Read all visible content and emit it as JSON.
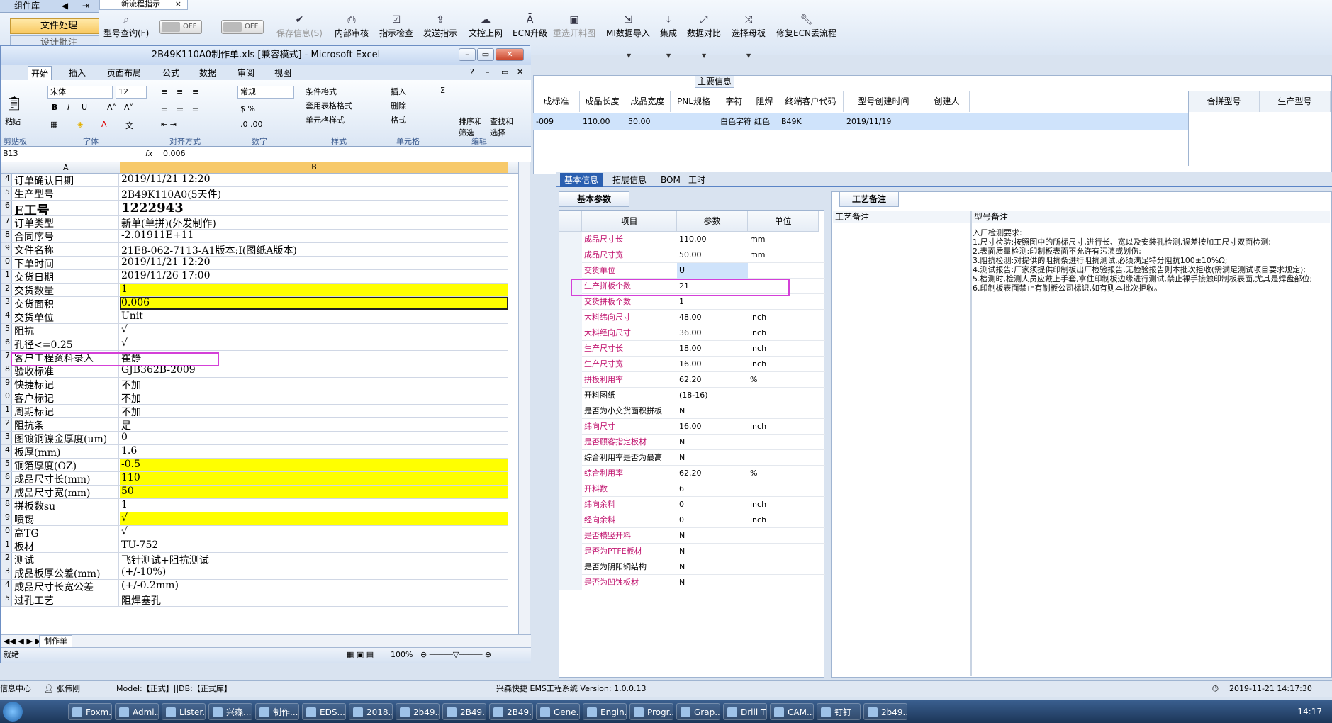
{
  "app": {
    "left_header": "组件库",
    "left_btn1": "文件处理",
    "left_btn2": "设计批注",
    "tab_label": "新流程指示"
  },
  "toolbar": {
    "buttons": [
      {
        "label": "型号查询(F)",
        "icon": "search-icon"
      },
      {
        "label": "OFF"
      },
      {
        "label": "OFF"
      },
      {
        "label": "保存信息(S)",
        "icon": "check-icon",
        "dim": true
      },
      {
        "label": "内部审核",
        "icon": "print-icon"
      },
      {
        "label": "指示检查",
        "icon": "checklist-icon"
      },
      {
        "label": "发送指示",
        "icon": "upload-icon"
      },
      {
        "label": "文控上网",
        "icon": "cloud-icon"
      },
      {
        "label": "ECN升级",
        "icon": "ecn-icon"
      },
      {
        "label": "重选开料图",
        "icon": "image-icon",
        "dim": true
      },
      {
        "label": "MI数据导入",
        "icon": "import-icon"
      },
      {
        "label": "集成",
        "icon": "download-icon"
      },
      {
        "label": "数据对比",
        "icon": "compare-icon"
      },
      {
        "label": "选择母板",
        "icon": "shuffle-icon"
      },
      {
        "label": "修复ECN丢流程",
        "icon": "wrench-icon"
      }
    ]
  },
  "main": {
    "title": "主要信息",
    "headers": [
      "成标准",
      "成品长度",
      "成品宽度",
      "PNL规格",
      "字符",
      "阻焊",
      "终端客户代码",
      "型号创建时间",
      "创建人"
    ],
    "row": [
      "-009",
      "110.00",
      "50.00",
      "",
      "白色字符",
      "红色",
      "B49K",
      "2019/11/19",
      ""
    ],
    "merge_headers": [
      "合拼型号",
      "生产型号"
    ]
  },
  "subtabs": [
    "基本信息",
    "拓展信息",
    "BOM",
    "工时"
  ],
  "params": {
    "title": "基本参数",
    "headers": [
      "项目",
      "参数",
      "单位"
    ],
    "rows": [
      [
        "成品尺寸长",
        "110.00",
        "mm",
        true
      ],
      [
        "成品尺寸宽",
        "50.00",
        "mm",
        true
      ],
      [
        "交货单位",
        "U",
        "",
        true
      ],
      [
        "生产拼板个数",
        "21",
        "",
        true
      ],
      [
        "交货拼板个数",
        "1",
        "",
        true
      ],
      [
        "大料纬向尺寸",
        "48.00",
        "inch",
        true
      ],
      [
        "大料经向尺寸",
        "36.00",
        "inch",
        true
      ],
      [
        "生产尺寸长",
        "18.00",
        "inch",
        true
      ],
      [
        "生产尺寸宽",
        "16.00",
        "inch",
        true
      ],
      [
        "拼板利用率",
        "62.20",
        "%",
        true
      ],
      [
        "开料图纸",
        "(18-16)",
        "",
        false
      ],
      [
        "是否为小交货面积拼板",
        "N",
        "",
        false
      ],
      [
        "纬向尺寸",
        "16.00",
        "inch",
        true
      ],
      [
        "是否顾客指定板材",
        "N",
        "",
        true
      ],
      [
        "综合利用率是否为最高",
        "N",
        "",
        false
      ],
      [
        "综合利用率",
        "62.20",
        "%",
        true
      ],
      [
        "开料数",
        "6",
        "",
        true
      ],
      [
        "纬向余料",
        "0",
        "inch",
        true
      ],
      [
        "经向余料",
        "0",
        "inch",
        true
      ],
      [
        "是否横竖开料",
        "N",
        "",
        true
      ],
      [
        "是否为PTFE板材",
        "N",
        "",
        true
      ],
      [
        "是否为阴阳铜结构",
        "N",
        "",
        false
      ],
      [
        "是否为凹蚀板材",
        "N",
        "",
        true
      ]
    ]
  },
  "process": {
    "title": "工艺备注",
    "col1": "工艺备注",
    "col2": "型号备注",
    "notes": [
      "入厂检测要求:",
      "1.尺寸检验:按照图中的所标尺寸,进行长、宽以及安装孔检测,误差按加工尺寸双面检测;",
      "2.表面质量检测:印制板表面不允许有污渍或划伤;",
      "3.阻抗检测:对提供的阻抗条进行阻抗测试,必须满足特分阻抗100±10%Ω;",
      "4.测试报告:厂家须提供印制板出厂检验报告,无检验报告则本批次拒收(需满足测试项目要求规定);",
      "5.检测时,检测人员应戴上手套,拿住印制板边缘进行测试,禁止裸手接触印制板表面,尤其是焊盘部位;",
      "6.印制板表面禁止有制板公司标识,如有则本批次拒收。"
    ]
  },
  "status": {
    "left": "信息中心",
    "user": "张伟刚",
    "model": "Model:【正式】||DB:【正式库】",
    "mid": "兴森快捷 EMS工程系统 Version: 1.0.0.13",
    "datetime": "2019-11-21 14:17:30"
  },
  "excel": {
    "title": "2B49K110A0制作单.xls [兼容模式] - Microsoft Excel",
    "tabs": [
      "开始",
      "插入",
      "页面布局",
      "公式",
      "数据",
      "审阅",
      "视图"
    ],
    "font_name": "宋体",
    "font_size": "12",
    "number_format": "常规",
    "groups": [
      "剪贴板",
      "字体",
      "对齐方式",
      "数字",
      "样式",
      "单元格",
      "编辑"
    ],
    "paste": "粘贴",
    "styles": [
      "条件格式",
      "套用表格格式",
      "单元格样式"
    ],
    "cells": [
      "插入",
      "删除",
      "格式"
    ],
    "edit": [
      "排序和筛选",
      "查找和选择"
    ],
    "name_box": "B13",
    "formula": "0.006",
    "col_a": "A",
    "col_b": "B",
    "rows": [
      [
        "4",
        "订单确认日期",
        "2019/11/21 12:20",
        false
      ],
      [
        "5",
        "生产型号",
        "2B49K110A0(5天件)",
        false
      ],
      [
        "6",
        "E工号",
        "1222943",
        false
      ],
      [
        "7",
        "订单类型",
        "新单(单拼)(外发制作)",
        false
      ],
      [
        "8",
        "合同序号",
        "-2.01911E+11",
        false
      ],
      [
        "9",
        "文件名称",
        "21E8-062-7113-A1版本:I(图纸A版本)",
        false
      ],
      [
        "0",
        "下单时间",
        "2019/11/21 12:20",
        false
      ],
      [
        "1",
        "交货日期",
        "2019/11/26 17:00",
        false
      ],
      [
        "2",
        "交货数量",
        "1",
        true
      ],
      [
        "3",
        "交货面积",
        "0.006",
        true
      ],
      [
        "4",
        "交货单位",
        "Unit",
        false
      ],
      [
        "5",
        "阻抗",
        "√",
        false
      ],
      [
        "6",
        "孔径<=0.25",
        "√",
        false
      ],
      [
        "7",
        "客户工程资料录入",
        "崔静",
        false
      ],
      [
        "8",
        "验收标准",
        "GJB362B-2009",
        false
      ],
      [
        "9",
        "快捷标记",
        "不加",
        false
      ],
      [
        "0",
        "客户标记",
        "不加",
        false
      ],
      [
        "1",
        "周期标记",
        "不加",
        false
      ],
      [
        "2",
        "阻抗条",
        "是",
        false
      ],
      [
        "3",
        "图镀铜镍金厚度(um)",
        "0",
        false
      ],
      [
        "4",
        "板厚(mm)",
        "1.6",
        false
      ],
      [
        "5",
        "铜箔厚度(OZ)",
        "-0.5",
        true
      ],
      [
        "6",
        "成品尺寸长(mm)",
        "110",
        true
      ],
      [
        "7",
        "成品尺寸宽(mm)",
        "50",
        true
      ],
      [
        "8",
        "拼板数su",
        "1",
        false
      ],
      [
        "9",
        "喷锡",
        "√",
        true
      ],
      [
        "0",
        "高TG",
        "√",
        false
      ],
      [
        "1",
        "板材",
        "TU-752",
        false
      ],
      [
        "2",
        "测试",
        "飞针测试+阻抗测试",
        false
      ],
      [
        "3",
        "成品板厚公差(mm)",
        "(+/-10%)",
        false
      ],
      [
        "4",
        "成品尺寸长宽公差",
        "(+/-0.2mm)",
        false
      ],
      [
        "5",
        "过孔工艺",
        "阻焊塞孔",
        false
      ]
    ],
    "sheet_tab": "制作单",
    "zoom": "100%",
    "ready": "就绪"
  },
  "taskbar": {
    "items": [
      "Foxm...",
      "Admi...",
      "Lister...",
      "兴森...",
      "制作...",
      "EDS...",
      "2018...",
      "2b49...",
      "2B49...",
      "2B49...",
      "Gene...",
      "Engin...",
      "Progr...",
      "Grap...",
      "Drill T...",
      "CAM...",
      "钉钉",
      "2b49..."
    ],
    "clock": "14:17"
  }
}
